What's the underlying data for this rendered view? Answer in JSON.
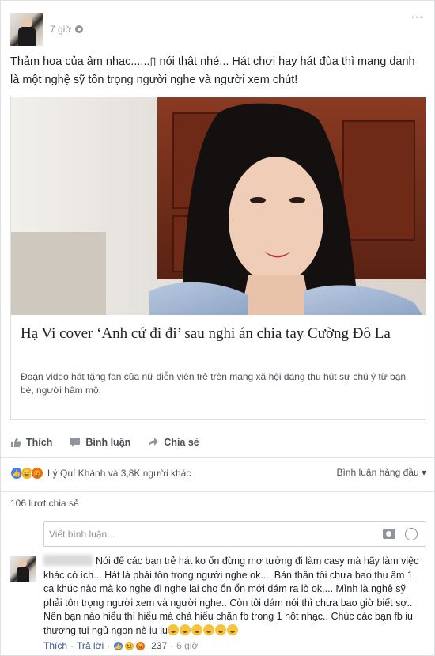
{
  "post": {
    "time": "7 giờ",
    "more": "···",
    "text": "Thảm hoạ của âm nhạc......▯ nói thật nhé... Hát chơi hay hát đùa thì mang danh là một nghệ sỹ tôn trọng người nghe và người xem chút!"
  },
  "preview": {
    "title": "Hạ Vi cover ‘Anh cứ đi đi’ sau nghi án chia tay Cường Đô La",
    "description": "Đoạn video hát tặng fan của nữ diễn viên trẻ trên mạng xã hội đang thu hút sự chú ý từ bạn bè, người hâm mộ."
  },
  "actions": {
    "like": "Thích",
    "comment": "Bình luận",
    "share": "Chia sẻ"
  },
  "reactions": {
    "names": "Lý Quí Khánh và 3,8K người khác",
    "sort": "Bình luận hàng đầu"
  },
  "shares": "106 lượt chia sẻ",
  "comment_box": {
    "placeholder": "Viết bình luận..."
  },
  "comment": {
    "text": "Nói để các bạn trẻ hát ko ổn đừng mơ tưởng đi làm casy mà hãy làm việc khác có ích... Hát là phải tôn trọng người nghe ok.... Bản thân tôi chưa bao thu âm 1 ca khúc nào mà ko nghe đi nghe lại cho ổn ổn mới dám ra lò ok.... Mình là nghệ sỹ phải tôn trọng người xem và người nghe.. Còn tôi dám nói thì chưa bao giờ biết sợ.. Nên bạn nào hiểu thì hiểu mà chả hiểu chặn fb trong 1 nốt nhạc.. Chúc các bạn fb iu thương tui ngủ ngon nè iu iu",
    "like": "Thích",
    "reply": "Trả lời",
    "count": "237",
    "time": "6 giờ"
  }
}
